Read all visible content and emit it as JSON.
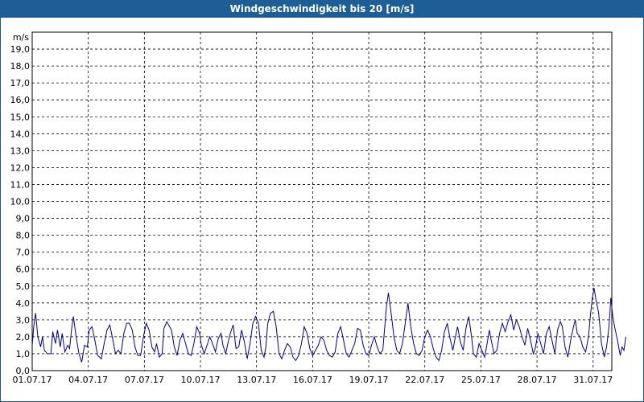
{
  "title": "Windgeschwindigkeit bis 20 [m/s]",
  "colors": {
    "title_bar": "#1d5e97",
    "series": "#00008b",
    "grid": "#000000"
  },
  "chart_data": {
    "type": "line",
    "title": "Windgeschwindigkeit bis 20 [m/s]",
    "ylabel": "m/s",
    "xlabel": "",
    "ylim": [
      0,
      20
    ],
    "xlim_days": [
      0,
      31
    ],
    "grid": true,
    "y_ticks": [
      "0,0",
      "1,0",
      "2,0",
      "3,0",
      "4,0",
      "5,0",
      "6,0",
      "7,0",
      "8,0",
      "9,0",
      "10,0",
      "11,0",
      "12,0",
      "13,0",
      "14,0",
      "15,0",
      "16,0",
      "17,0",
      "18,0",
      "19,0"
    ],
    "x_ticks": [
      "01.07.17",
      "04.07.17",
      "07.07.17",
      "10.07.17",
      "13.07.17",
      "16.07.17",
      "19.07.17",
      "22.07.17",
      "25.07.17",
      "28.07.17",
      "31.07.17"
    ],
    "series": [
      {
        "values": [
          [
            0.0,
            1.5
          ],
          [
            0.08,
            2.6
          ],
          [
            0.18,
            3.4
          ],
          [
            0.3,
            2.0
          ],
          [
            0.45,
            1.4
          ],
          [
            0.55,
            2.0
          ],
          [
            0.65,
            1.2
          ],
          [
            0.8,
            1.0
          ],
          [
            1.0,
            1.0
          ],
          [
            1.1,
            2.3
          ],
          [
            1.25,
            1.6
          ],
          [
            1.35,
            2.4
          ],
          [
            1.5,
            1.4
          ],
          [
            1.6,
            2.2
          ],
          [
            1.75,
            1.1
          ],
          [
            1.9,
            1.5
          ],
          [
            2.0,
            1.3
          ],
          [
            2.1,
            2.4
          ],
          [
            2.2,
            3.2
          ],
          [
            2.35,
            2.0
          ],
          [
            2.5,
            1.0
          ],
          [
            2.65,
            0.5
          ],
          [
            2.8,
            1.5
          ],
          [
            2.95,
            1.4
          ],
          [
            3.05,
            2.4
          ],
          [
            3.2,
            2.6
          ],
          [
            3.35,
            1.8
          ],
          [
            3.5,
            0.9
          ],
          [
            3.7,
            0.7
          ],
          [
            3.85,
            1.6
          ],
          [
            4.0,
            2.4
          ],
          [
            4.15,
            2.7
          ],
          [
            4.3,
            1.9
          ],
          [
            4.45,
            1.0
          ],
          [
            4.6,
            1.2
          ],
          [
            4.75,
            1.0
          ],
          [
            4.9,
            2.2
          ],
          [
            5.05,
            2.8
          ],
          [
            5.2,
            2.8
          ],
          [
            5.35,
            2.4
          ],
          [
            5.5,
            1.4
          ],
          [
            5.65,
            0.9
          ],
          [
            5.8,
            0.9
          ],
          [
            5.95,
            2.0
          ],
          [
            6.1,
            2.8
          ],
          [
            6.25,
            2.4
          ],
          [
            6.4,
            1.4
          ],
          [
            6.55,
            1.1
          ],
          [
            6.65,
            1.6
          ],
          [
            6.8,
            0.8
          ],
          [
            6.95,
            1.0
          ],
          [
            7.05,
            2.5
          ],
          [
            7.2,
            2.9
          ],
          [
            7.3,
            2.7
          ],
          [
            7.45,
            2.4
          ],
          [
            7.6,
            1.4
          ],
          [
            7.75,
            0.9
          ],
          [
            7.9,
            1.8
          ],
          [
            8.05,
            2.2
          ],
          [
            8.2,
            1.6
          ],
          [
            8.35,
            1.0
          ],
          [
            8.5,
            0.9
          ],
          [
            8.65,
            1.6
          ],
          [
            8.8,
            2.6
          ],
          [
            8.95,
            2.2
          ],
          [
            9.05,
            1.5
          ],
          [
            9.2,
            1.0
          ],
          [
            9.35,
            1.5
          ],
          [
            9.5,
            2.0
          ],
          [
            9.65,
            1.6
          ],
          [
            9.8,
            1.1
          ],
          [
            9.95,
            1.9
          ],
          [
            10.1,
            2.2
          ],
          [
            10.2,
            1.5
          ],
          [
            10.35,
            1.0
          ],
          [
            10.5,
            1.8
          ],
          [
            10.65,
            2.4
          ],
          [
            10.75,
            2.7
          ],
          [
            10.9,
            1.3
          ],
          [
            11.05,
            1.4
          ],
          [
            11.2,
            2.4
          ],
          [
            11.35,
            1.7
          ],
          [
            11.5,
            0.7
          ],
          [
            11.65,
            1.6
          ],
          [
            11.8,
            2.8
          ],
          [
            11.95,
            3.2
          ],
          [
            12.1,
            2.8
          ],
          [
            12.25,
            1.2
          ],
          [
            12.4,
            0.8
          ],
          [
            12.5,
            1.4
          ],
          [
            12.6,
            2.8
          ],
          [
            12.75,
            3.4
          ],
          [
            12.9,
            3.5
          ],
          [
            13.05,
            2.6
          ],
          [
            13.2,
            1.0
          ],
          [
            13.35,
            0.7
          ],
          [
            13.5,
            1.2
          ],
          [
            13.65,
            1.6
          ],
          [
            13.8,
            1.4
          ],
          [
            13.95,
            0.8
          ],
          [
            14.1,
            0.6
          ],
          [
            14.25,
            0.9
          ],
          [
            14.4,
            1.6
          ],
          [
            14.55,
            2.6
          ],
          [
            14.7,
            2.2
          ],
          [
            14.85,
            1.3
          ],
          [
            15.0,
            0.9
          ],
          [
            15.15,
            1.2
          ],
          [
            15.3,
            1.5
          ],
          [
            15.45,
            2.0
          ],
          [
            15.6,
            1.8
          ],
          [
            15.75,
            1.2
          ],
          [
            15.9,
            0.9
          ],
          [
            16.05,
            0.8
          ],
          [
            16.2,
            1.1
          ],
          [
            16.35,
            2.2
          ],
          [
            16.5,
            2.6
          ],
          [
            16.65,
            1.8
          ],
          [
            16.8,
            1.0
          ],
          [
            16.95,
            0.8
          ],
          [
            17.1,
            1.2
          ],
          [
            17.25,
            1.6
          ],
          [
            17.4,
            2.5
          ],
          [
            17.55,
            2.4
          ],
          [
            17.7,
            1.5
          ],
          [
            17.85,
            1.0
          ],
          [
            18.0,
            0.9
          ],
          [
            18.15,
            1.5
          ],
          [
            18.3,
            2.0
          ],
          [
            18.45,
            1.4
          ],
          [
            18.6,
            1.0
          ],
          [
            18.75,
            1.2
          ],
          [
            18.85,
            2.5
          ],
          [
            18.95,
            3.8
          ],
          [
            19.05,
            4.6
          ],
          [
            19.2,
            3.4
          ],
          [
            19.35,
            2.0
          ],
          [
            19.5,
            1.2
          ],
          [
            19.65,
            1.0
          ],
          [
            19.8,
            1.6
          ],
          [
            19.95,
            2.8
          ],
          [
            20.1,
            4.0
          ],
          [
            20.25,
            2.6
          ],
          [
            20.4,
            1.6
          ],
          [
            20.55,
            1.0
          ],
          [
            20.7,
            0.9
          ],
          [
            20.85,
            1.2
          ],
          [
            21.0,
            2.0
          ],
          [
            21.15,
            2.4
          ],
          [
            21.3,
            2.0
          ],
          [
            21.45,
            1.3
          ],
          [
            21.6,
            0.8
          ],
          [
            21.75,
            0.6
          ],
          [
            21.9,
            1.2
          ],
          [
            22.05,
            2.3
          ],
          [
            22.2,
            2.8
          ],
          [
            22.35,
            1.9
          ],
          [
            22.5,
            1.2
          ],
          [
            22.6,
            1.8
          ],
          [
            22.75,
            2.6
          ],
          [
            22.9,
            1.7
          ],
          [
            23.05,
            1.2
          ],
          [
            23.2,
            2.5
          ],
          [
            23.35,
            3.2
          ],
          [
            23.5,
            2.0
          ],
          [
            23.6,
            1.0
          ],
          [
            23.75,
            0.8
          ],
          [
            23.9,
            1.6
          ],
          [
            24.05,
            1.2
          ],
          [
            24.2,
            0.8
          ],
          [
            24.3,
            1.4
          ],
          [
            24.45,
            2.4
          ],
          [
            24.55,
            1.8
          ],
          [
            24.7,
            1.0
          ],
          [
            24.85,
            1.2
          ],
          [
            25.0,
            2.2
          ],
          [
            25.15,
            2.8
          ],
          [
            25.3,
            2.3
          ],
          [
            25.45,
            2.9
          ],
          [
            25.6,
            3.3
          ],
          [
            25.75,
            2.4
          ],
          [
            25.9,
            3.0
          ],
          [
            26.05,
            2.6
          ],
          [
            26.2,
            2.0
          ],
          [
            26.35,
            1.5
          ],
          [
            26.5,
            2.5
          ],
          [
            26.65,
            1.8
          ],
          [
            26.8,
            1.0
          ],
          [
            26.9,
            1.3
          ],
          [
            27.05,
            2.2
          ],
          [
            27.2,
            1.6
          ],
          [
            27.35,
            1.0
          ],
          [
            27.5,
            2.2
          ],
          [
            27.65,
            2.6
          ],
          [
            27.8,
            1.8
          ],
          [
            27.95,
            1.0
          ],
          [
            28.1,
            2.4
          ],
          [
            28.25,
            2.9
          ],
          [
            28.35,
            2.6
          ],
          [
            28.5,
            1.4
          ],
          [
            28.65,
            0.8
          ],
          [
            28.8,
            1.8
          ],
          [
            28.95,
            2.6
          ],
          [
            29.05,
            3.0
          ],
          [
            29.15,
            2.2
          ],
          [
            29.3,
            2.0
          ],
          [
            29.45,
            1.4
          ],
          [
            29.6,
            1.1
          ],
          [
            29.75,
            2.0
          ],
          [
            29.85,
            3.2
          ],
          [
            29.95,
            4.2
          ],
          [
            30.05,
            4.9
          ],
          [
            30.15,
            4.2
          ],
          [
            30.3,
            3.4
          ],
          [
            30.45,
            1.6
          ],
          [
            30.6,
            0.8
          ],
          [
            30.72,
            1.4
          ],
          [
            30.85,
            2.6
          ],
          [
            30.95,
            4.3
          ],
          [
            31.05,
            3.2
          ],
          [
            31.15,
            2.6
          ],
          [
            31.3,
            1.8
          ],
          [
            31.45,
            0.9
          ],
          [
            31.55,
            1.4
          ],
          [
            31.65,
            1.2
          ],
          [
            31.75,
            2.0
          ]
        ]
      }
    ]
  }
}
